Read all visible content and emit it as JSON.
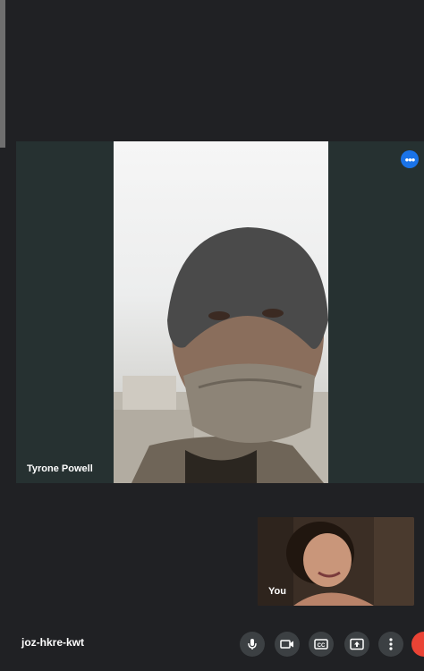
{
  "meeting": {
    "code": "joz-hkre-kwt"
  },
  "participants": {
    "main": {
      "name": "Tyrone Powell"
    },
    "self": {
      "label": "You"
    }
  },
  "controls": {
    "icons": [
      "microphone-icon",
      "camera-icon",
      "captions-icon",
      "present-screen-icon",
      "more-options-icon",
      "end-call-icon"
    ]
  },
  "colors": {
    "background": "#202124",
    "tile": "#263131",
    "accent": "#1a73e8",
    "control": "#3c4043",
    "end_call": "#ea4335"
  }
}
